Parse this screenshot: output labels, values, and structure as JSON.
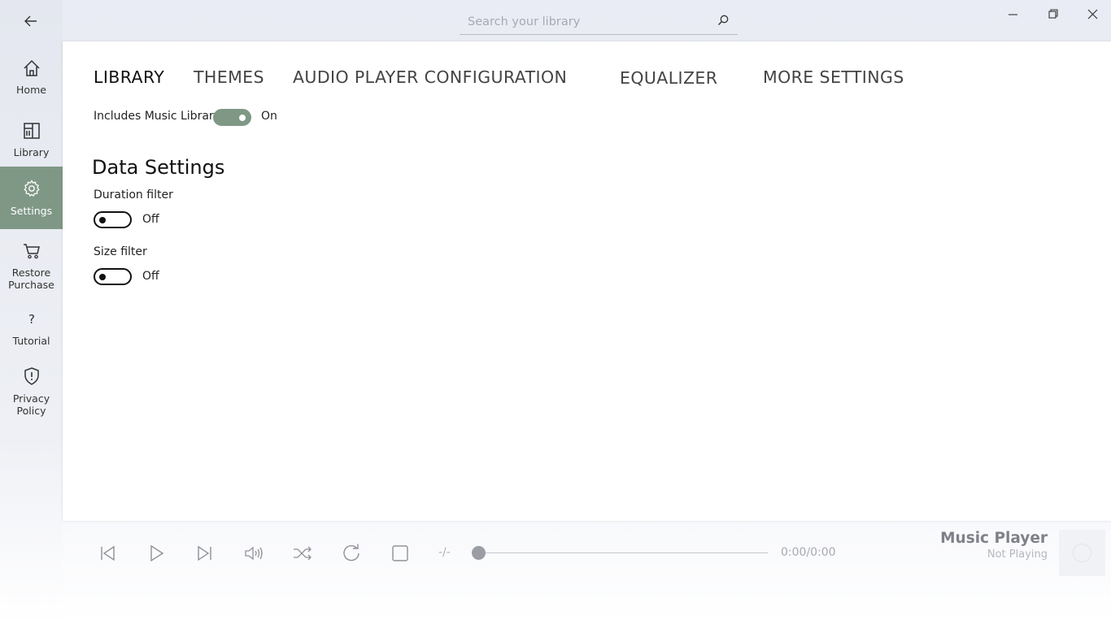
{
  "search": {
    "placeholder": "Search your library"
  },
  "nav": {
    "home": "Home",
    "library": "Library",
    "settings": "Settings",
    "restore_1": "Restore",
    "restore_2": "Purchase",
    "tutorial": "Tutorial",
    "privacy_1": "Privacy",
    "privacy_2": "Policy"
  },
  "tabs": [
    "LIBRARY",
    "THEMES",
    "AUDIO PLAYER CONFIGURATION",
    "EQUALIZER",
    "MORE SETTINGS"
  ],
  "library": {
    "includes_music_label": "Includes Music Library",
    "includes_music_state": "On",
    "data_settings_title": "Data Settings",
    "duration_label": "Duration filter",
    "duration_state": "Off",
    "size_label": "Size filter",
    "size_state": "Off"
  },
  "player": {
    "rate": "-/-",
    "time": "0:00/0:00",
    "title": "Music Player",
    "status": "Not Playing",
    "seek_position": 0
  },
  "colors": {
    "accent": "#7f9886"
  }
}
